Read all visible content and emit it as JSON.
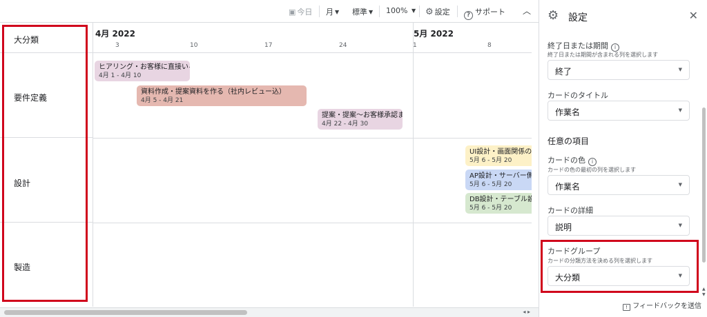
{
  "toolbar": {
    "today": "今日",
    "month": "月",
    "scale": "標準",
    "zoom": "100%",
    "settings": "設定",
    "support": "サポート",
    "collapse_icon": "chevron-up-icon"
  },
  "groups": {
    "header": "大分類",
    "rows": [
      "要件定義",
      "設計",
      "製造"
    ]
  },
  "timeline": {
    "months": [
      "4月 2022",
      "5月 2022"
    ],
    "days": [
      "3",
      "10",
      "17",
      "24",
      "1",
      "8"
    ],
    "cards": [
      {
        "title": "ヒアリング・お客様に直接いろいろ聞く",
        "dates": "4月 1 - 4月 10",
        "color": "#e8d5e2"
      },
      {
        "title": "資料作成・提案資料を作る（社内レビュー込）",
        "dates": "4月 5 - 4月 21",
        "color": "#e5b8b0"
      },
      {
        "title": "提案・提案〜お客様承認まで",
        "dates": "4月 22 - 4月 30",
        "color": "#e8d5e2"
      },
      {
        "title": "UI設計・画面関係の設",
        "dates": "5月 6 - 5月 20",
        "color": "#fdf1c7"
      },
      {
        "title": "AP設計・サーバー側",
        "dates": "5月 6 - 5月 20",
        "color": "#c9d8f5"
      },
      {
        "title": "DB設計・テーブル設",
        "dates": "5月 6 - 5月 20",
        "color": "#d6e8cf"
      }
    ]
  },
  "panel": {
    "title": "設定",
    "end_label": "終了日または期間",
    "end_sub": "終了日または期間が含まれる列を選択します",
    "end_value": "終了",
    "card_title_label": "カードのタイトル",
    "card_title_value": "作業名",
    "optional_section": "任意の項目",
    "card_color_label": "カードの色",
    "card_color_sub": "カードの色の最初の列を選択します",
    "card_color_value": "作業名",
    "card_detail_label": "カードの詳細",
    "card_detail_value": "説明",
    "card_group_label": "カードグループ",
    "card_group_sub": "カードの分類方法を決める列を選択します",
    "card_group_value": "大分類",
    "feedback": "フィードバックを送信"
  },
  "colors": {
    "highlight": "#d0021b",
    "grid": "#dadce0"
  }
}
